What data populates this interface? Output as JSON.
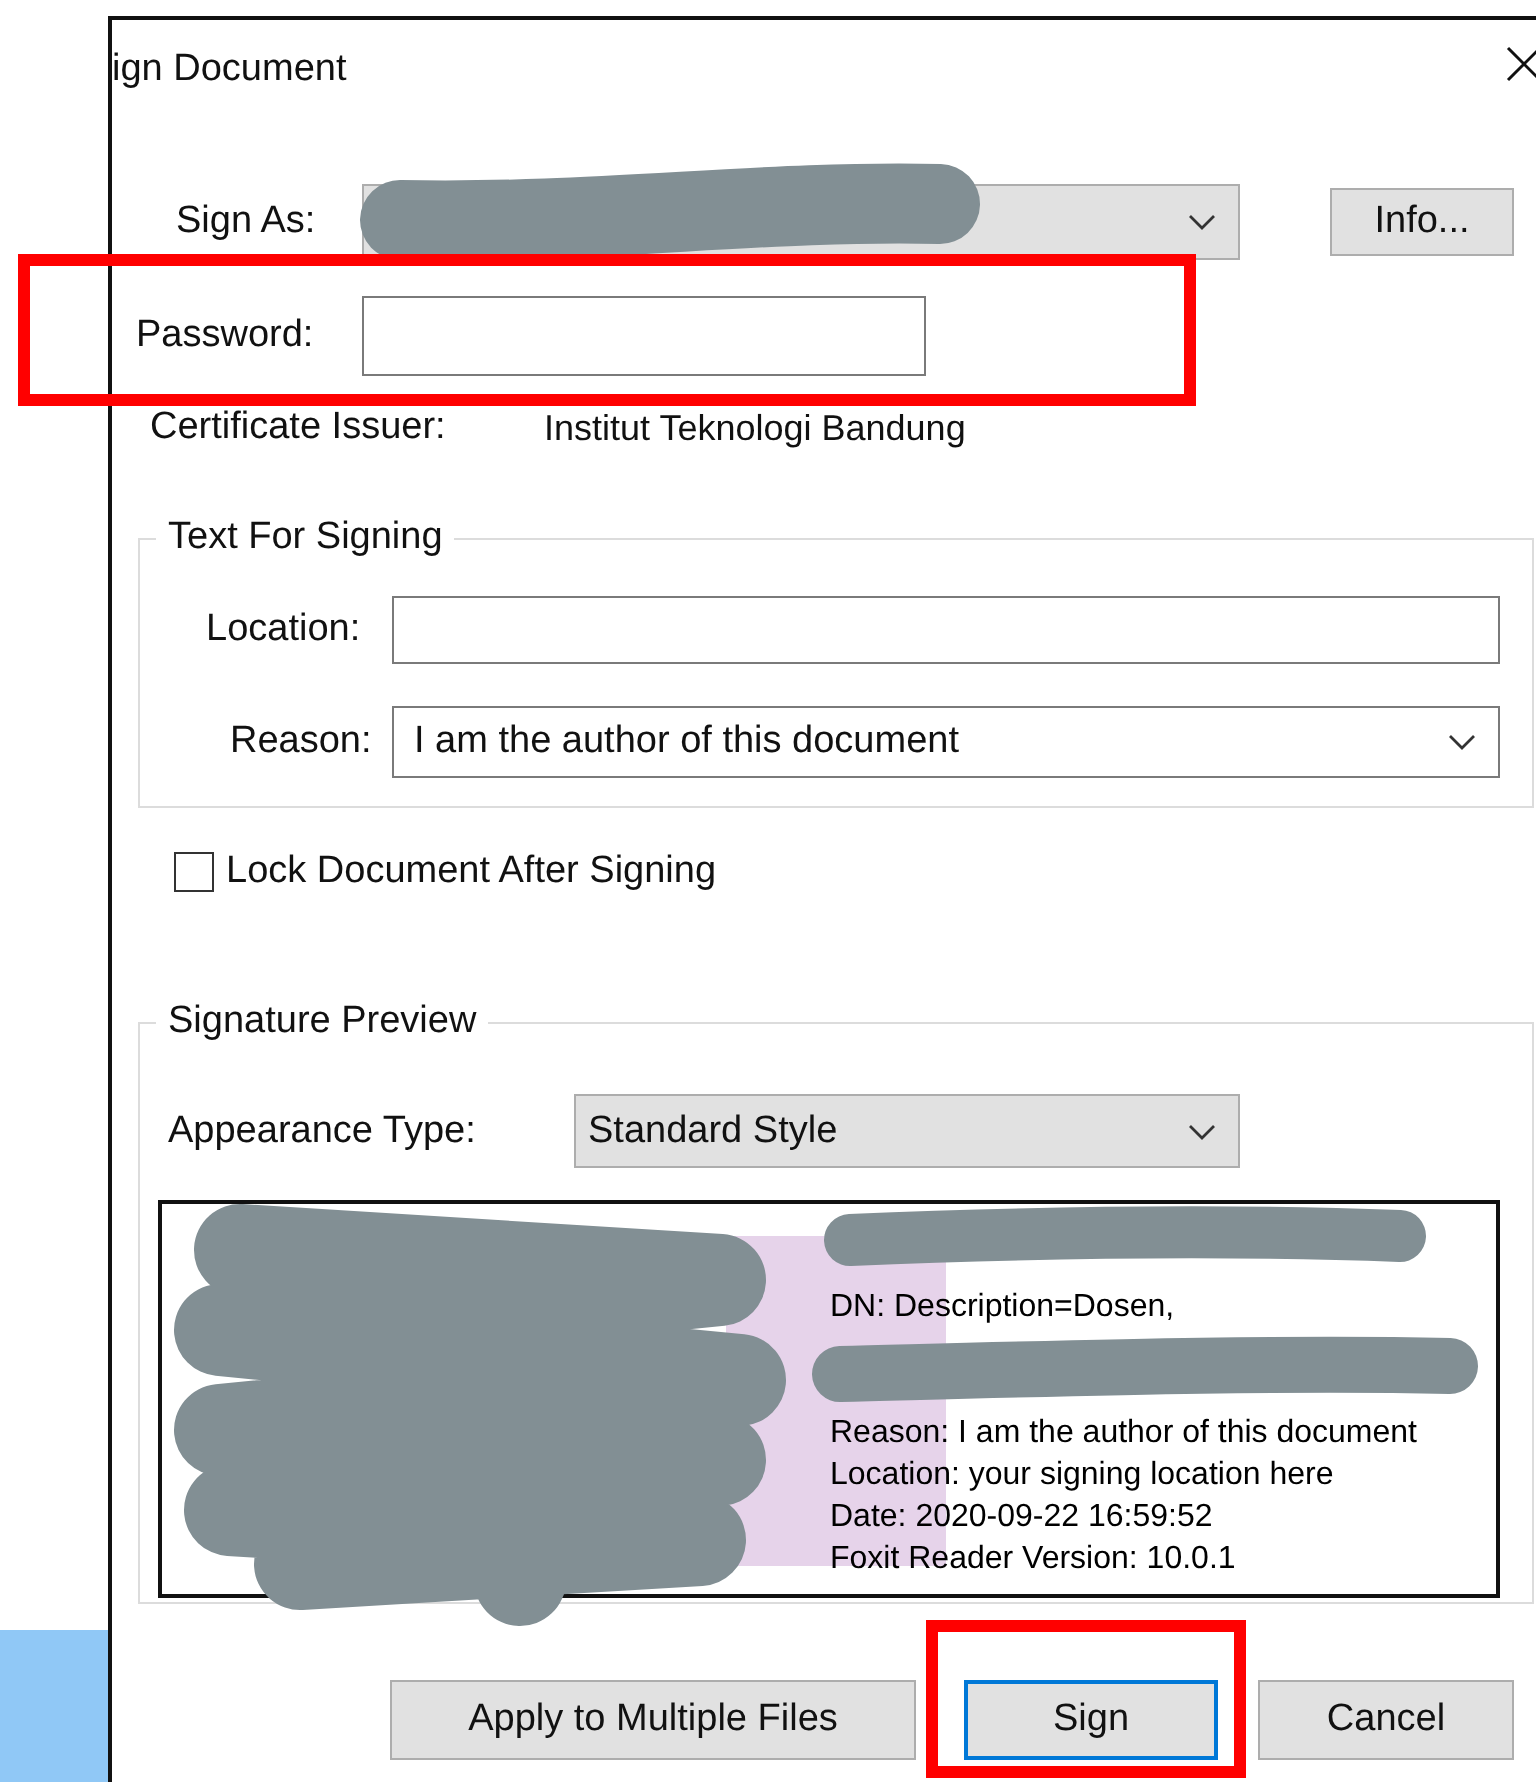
{
  "window": {
    "title": "ign Document"
  },
  "sign_as": {
    "label": "Sign As:"
  },
  "info_button": {
    "label": "Info..."
  },
  "password": {
    "label": "Password:"
  },
  "certificate_issuer": {
    "label": "Certificate Issuer:",
    "value": "Institut Teknologi Bandung"
  },
  "text_for_signing": {
    "title": "Text For Signing",
    "location": {
      "label": "Location:"
    },
    "reason": {
      "label": "Reason:",
      "value": "I am the author of this document"
    }
  },
  "lock_document": {
    "label": "Lock Document After Signing",
    "checked": false
  },
  "signature_preview": {
    "title": "Signature Preview",
    "appearance_type": {
      "label": "Appearance Type:",
      "value": "Standard Style"
    },
    "upper_lines": [
      "DN: Description=Dosen,"
    ],
    "lower_lines": [
      "Reason: I am the author of this document",
      "Location: your signing location here",
      "Date: 2020-09-22 16:59:52",
      "Foxit Reader Version: 10.0.1"
    ]
  },
  "buttons": [
    {
      "label": "Apply to Multiple Files",
      "focused": false
    },
    {
      "label": "Sign",
      "focused": true
    },
    {
      "label": "Cancel",
      "focused": false
    }
  ]
}
